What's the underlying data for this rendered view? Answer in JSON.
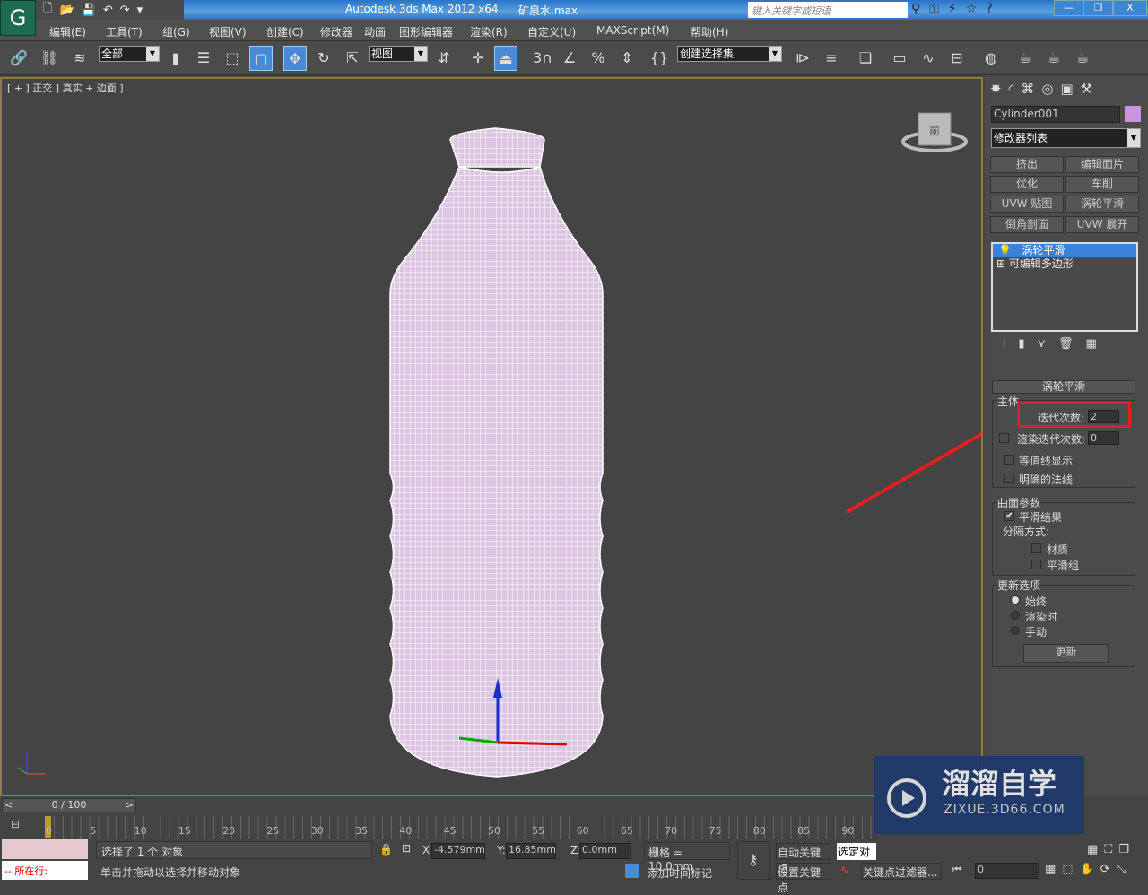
{
  "titlebar": {
    "app_title": "Autodesk 3ds Max  2012 x64",
    "file": "矿泉水.max",
    "search_placeholder": "键入关键字或短语"
  },
  "menu": [
    "编辑(E)",
    "工具(T)",
    "组(G)",
    "视图(V)",
    "创建(C)",
    "修改器",
    "动画",
    "图形编辑器",
    "渲染(R)",
    "自定义(U)",
    "MAXScript(M)",
    "帮助(H)"
  ],
  "toolbar": {
    "filter": "全部",
    "ref_coord": "视图",
    "selection_set": "创建选择集",
    "snap_angle": "3"
  },
  "viewport": {
    "label": "[ + ] 正交 ] 真实 + 边面 ]",
    "viewcube_face": "前",
    "object_color": "#d8c0e0"
  },
  "command_panel": {
    "object_name": "Cylinder001",
    "object_color": "#c994e0",
    "modifier_list": "修改器列表",
    "modifier_buttons": [
      "挤出",
      "编辑面片",
      "优化",
      "车削",
      "UVW 贴图",
      "涡轮平滑",
      "倒角剖面",
      "UVW 展开"
    ],
    "stack": [
      {
        "label": "涡轮平滑",
        "selected": true
      },
      {
        "label": "可编辑多边形",
        "selected": false
      }
    ],
    "rollout_title": "涡轮平滑",
    "main_group": "主体",
    "iterations_label": "迭代次数:",
    "iterations": "2",
    "render_iters_label": "渲染迭代次数:",
    "render_iters": "0",
    "isoline": "等值线显示",
    "explicit_normals": "明确的法线",
    "surface_group": "曲面参数",
    "smooth_result": "平滑结果",
    "separate_by": "分隔方式:",
    "material": "材质",
    "smoothing_groups": "平滑组",
    "update_group": "更新选项",
    "always": "始终",
    "when_rendering": "渲染时",
    "manually": "手动",
    "update_button": "更新",
    "highlight_color": "#e0201e"
  },
  "timeline": {
    "frame": "0 / 100",
    "ticks": [
      "0",
      "5",
      "10",
      "15",
      "20",
      "25",
      "30",
      "35",
      "40",
      "45",
      "50",
      "55",
      "60",
      "65",
      "70",
      "75",
      "80",
      "85",
      "90"
    ]
  },
  "status": {
    "selected": "选择了 1 个 对象",
    "prompt": "单击并拖动以选择并移动对象",
    "script_line": "-- 所在行:",
    "x_label": "X:",
    "x": "-4.579mm",
    "y_label": "Y:",
    "y": "16.85mm",
    "z_label": "Z:",
    "z": "0.0mm",
    "grid": "栅格 = 10.0mm",
    "add_time_tag": "添加时间标记",
    "auto_key": "自动关键点",
    "set_key": "设置关键点",
    "selected_obj": "选定对",
    "key_filters": "关键点过滤器...",
    "current_frame": "0"
  },
  "watermark": {
    "brand": "溜溜自学",
    "url": "ZIXUE.3D66.COM"
  }
}
